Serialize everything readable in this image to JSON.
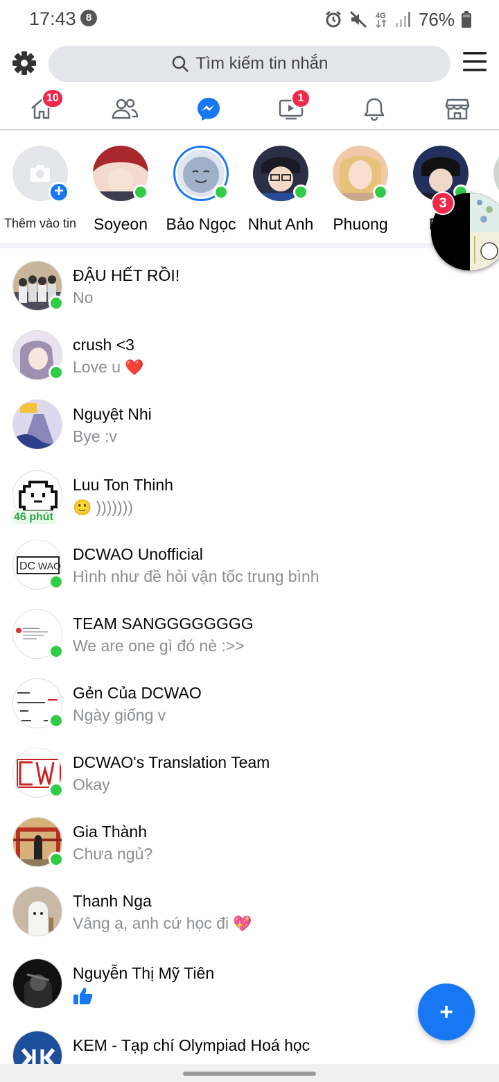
{
  "status_bar": {
    "time": "17:43",
    "notification_count": "8",
    "network": "4G",
    "battery": "76%"
  },
  "search": {
    "placeholder": "Tìm kiếm tin nhắn"
  },
  "tabs": [
    {
      "icon": "home-icon",
      "badge": "10"
    },
    {
      "icon": "friends-icon",
      "badge": ""
    },
    {
      "icon": "messenger-icon",
      "badge": ""
    },
    {
      "icon": "watch-icon",
      "badge": "1"
    },
    {
      "icon": "bell-icon",
      "badge": ""
    },
    {
      "icon": "marketplace-icon",
      "badge": ""
    }
  ],
  "stories": {
    "add_label": "Thêm vào tin",
    "items": [
      {
        "name": "Soyeon",
        "online": true
      },
      {
        "name": "Bảo Ngọc",
        "online": true
      },
      {
        "name": "Nhut Anh",
        "online": true
      },
      {
        "name": "Phuong",
        "online": true
      },
      {
        "name": "Rin",
        "online": true
      }
    ]
  },
  "chat_head": {
    "badge": "3"
  },
  "conversations": [
    {
      "name": "ĐẬU HẾT RỒI!",
      "message": "No",
      "online": true,
      "emoji": ""
    },
    {
      "name": "crush <3",
      "message": "Love u",
      "online": true,
      "emoji": "❤️"
    },
    {
      "name": "Nguyệt Nhi",
      "message": "Bye :v",
      "online": false,
      "emoji": ""
    },
    {
      "name": "Luu Ton Thinh",
      "message": ")))))))",
      "online": false,
      "emoji": "🙂",
      "time_tag": "46 phút"
    },
    {
      "name": "DCWAO Unofficial",
      "message": "Hình như đề hỏi vận tốc trung bình",
      "online": true,
      "emoji": ""
    },
    {
      "name": "TEAM SANGGGGGGGG",
      "message": "We are one gì đó nè :>>",
      "online": true,
      "emoji": ""
    },
    {
      "name": "Gẻn Của DCWAO",
      "message": "Ngày giống v",
      "online": true,
      "emoji": ""
    },
    {
      "name": "DCWAO's Translation Team",
      "message": "Okay",
      "online": true,
      "emoji": ""
    },
    {
      "name": "Gia Thành",
      "message": "Chưa ngủ?",
      "online": true,
      "emoji": ""
    },
    {
      "name": "Thanh Nga",
      "message": "Vâng ạ, anh cứ học đi",
      "online": false,
      "emoji": "💖"
    },
    {
      "name": "Nguyễn Thị Mỹ Tiên",
      "message": "",
      "online": false,
      "emoji": "👍"
    },
    {
      "name": "KEM - Tạp chí Olympiad Hoá học",
      "message": "",
      "online": false,
      "emoji": ""
    }
  ],
  "fab": {
    "label": "+"
  },
  "colors": {
    "accent": "#1877f2",
    "online": "#31cc46",
    "badge": "#f02849"
  }
}
